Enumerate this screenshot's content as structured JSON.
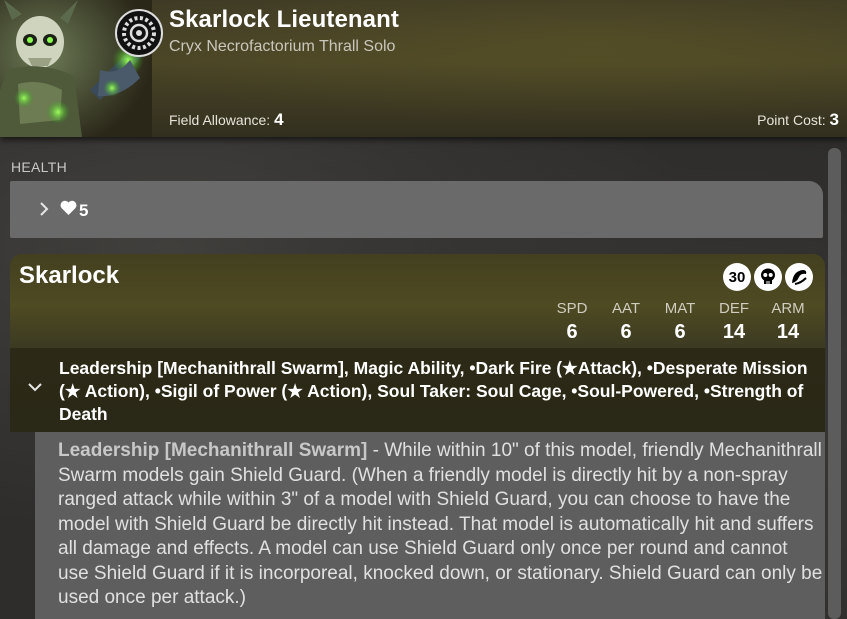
{
  "header": {
    "title": "Skarlock Lieutenant",
    "subtitle": "Cryx Necrofactorium Thrall Solo",
    "field_allowance_label": "Field Allowance:",
    "field_allowance_value": "4",
    "point_cost_label": "Point Cost:",
    "point_cost_value": "3",
    "portrait_icon": "skull-lieutenant-portrait",
    "faction_icon": "cryx-faction-emblem"
  },
  "health": {
    "label": "HEALTH",
    "value": "5",
    "icon": "heart-icon",
    "expand_icon": "chevron-right-icon"
  },
  "model": {
    "name": "Skarlock",
    "badges": [
      {
        "text": "30",
        "icon": "base-size-badge"
      },
      {
        "text": "",
        "icon": "skull-icon"
      },
      {
        "text": "",
        "icon": "soul-icon"
      }
    ],
    "stats": [
      {
        "label": "SPD",
        "value": "6"
      },
      {
        "label": "AAT",
        "value": "6"
      },
      {
        "label": "MAT",
        "value": "6"
      },
      {
        "label": "DEF",
        "value": "14"
      },
      {
        "label": "ARM",
        "value": "14"
      }
    ],
    "abilities_summary": "Leadership [Mechanithrall Swarm], Magic Ability, •Dark Fire (★Attack), •Desperate Mission (★ Action), •Sigil of Power (★ Action), Soul Taker: Soul Cage, •Soul-Powered, •Strength of Death",
    "collapse_icon": "chevron-down-icon",
    "ability_detail": {
      "name": "Leadership [Mechanithrall Swarm]",
      "text": " - While within 10\" of this model, friendly Mechanithrall Swarm models gain Shield Guard. (When a friendly model is directly hit by a non-spray ranged attack while within 3\" of a model with Shield Guard, you can choose to have the model with Shield Guard be directly hit instead. That model is automatically hit and suffers all damage and effects. A model can use Shield Guard only once per round and cannot use Shield Guard if it is incorporeal, knocked down, or stationary. Shield Guard can only be used once per attack.)"
    }
  },
  "colors": {
    "header_bg": "#4a4526",
    "health_bar": "#6a6a6a",
    "detail_bg": "#5e5e5e",
    "summary_bg": "#2c2a17"
  }
}
